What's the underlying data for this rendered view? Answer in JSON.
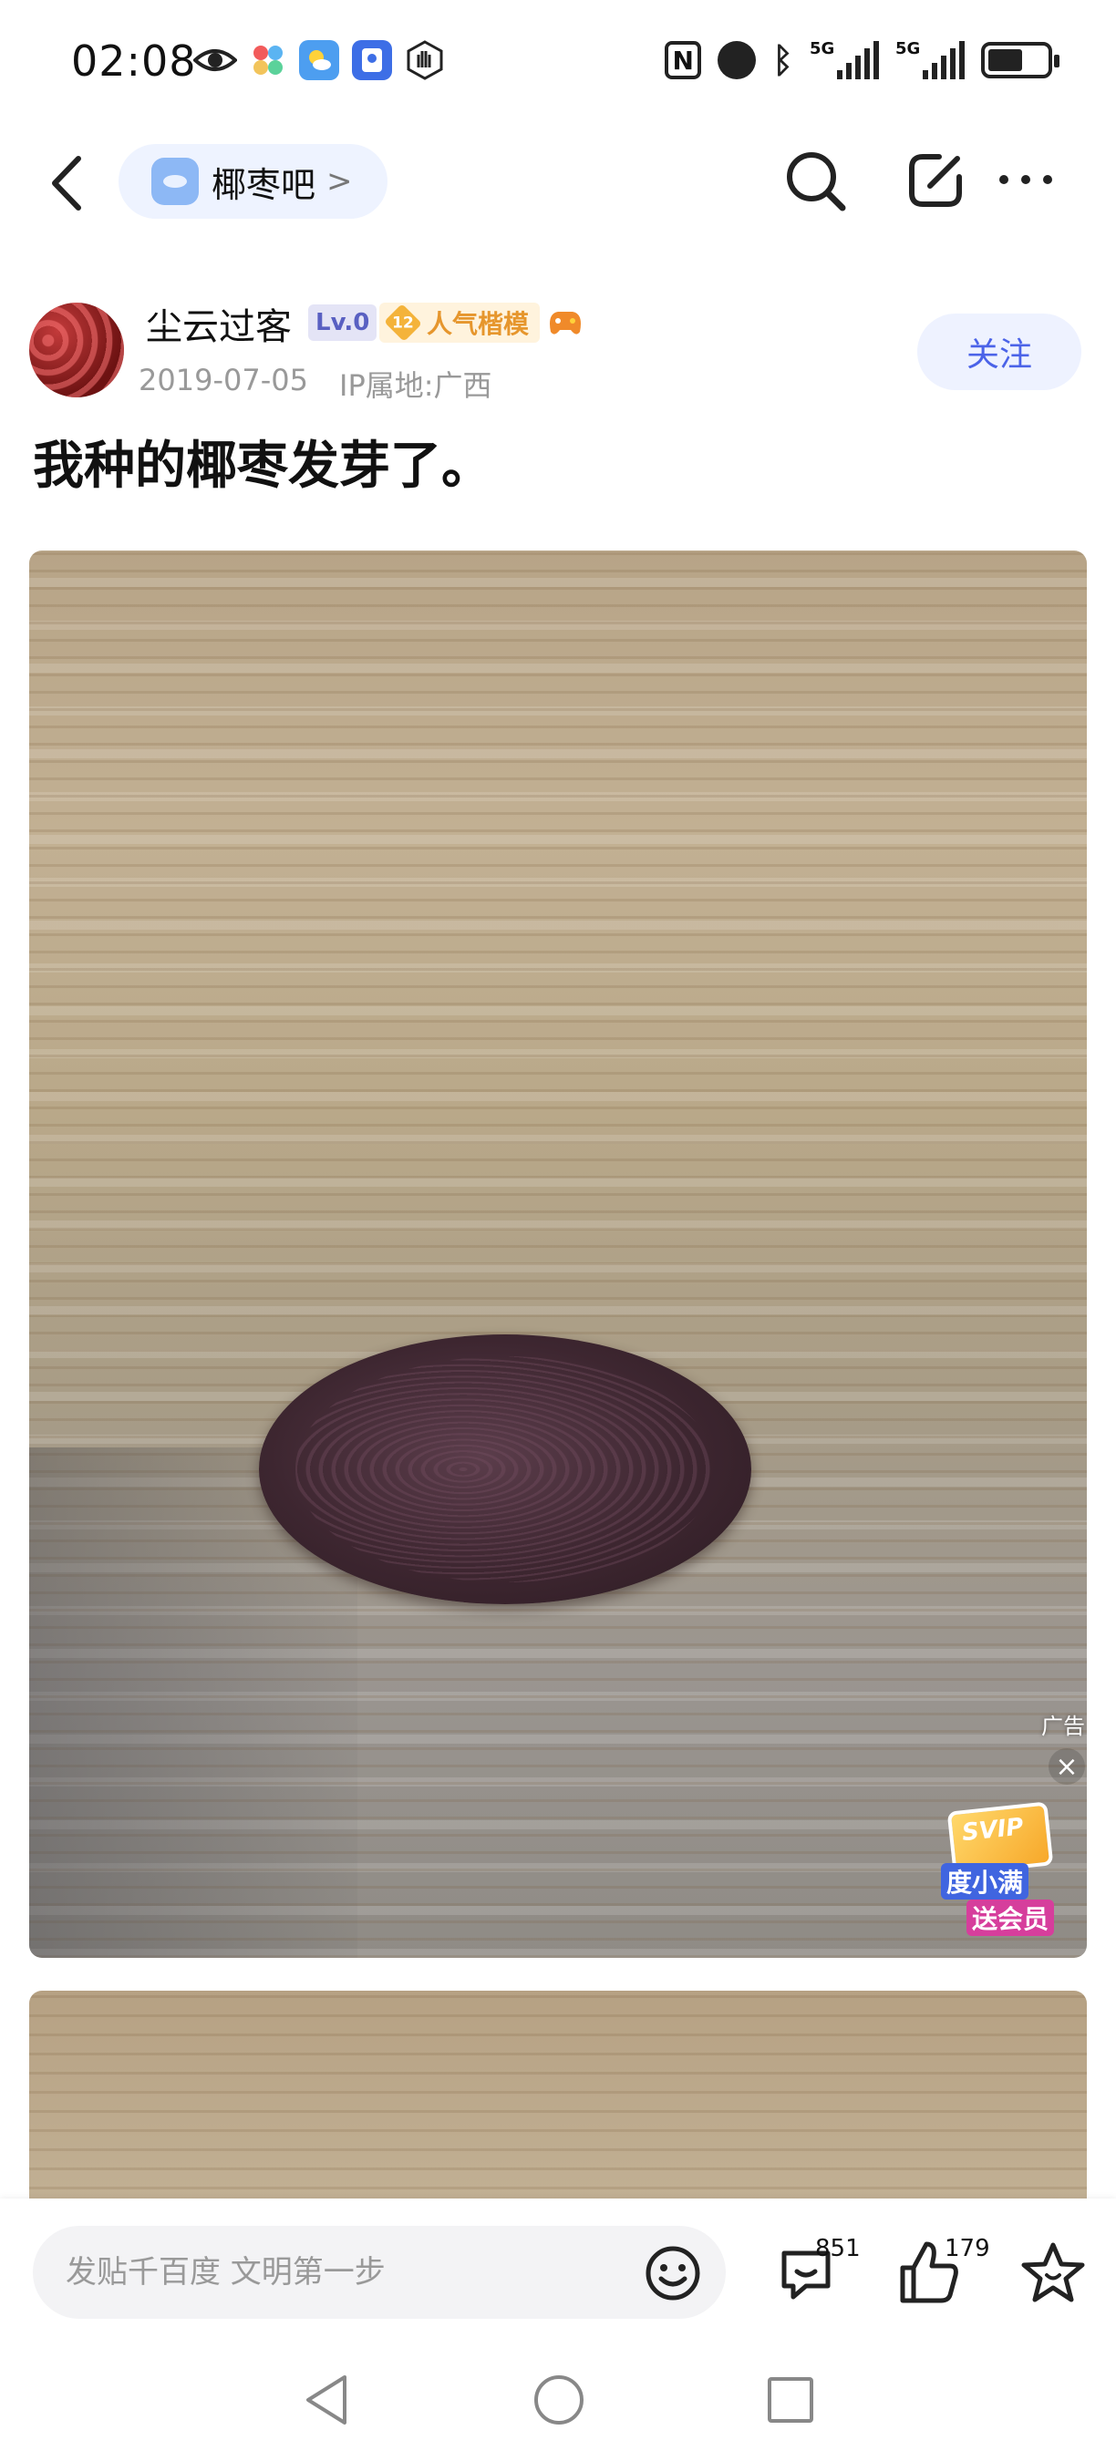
{
  "status_bar": {
    "time": "02:08",
    "left_icons": [
      "eye-icon",
      "pinwheel-icon",
      "weather-icon",
      "security-icon",
      "hand-icon"
    ],
    "right_icons": [
      "nfc-icon",
      "alarm-icon",
      "bluetooth-icon",
      "signal-5g-icon",
      "signal-5g-icon",
      "battery-icon"
    ],
    "network_label_1": "5G",
    "network_label_2": "5G",
    "nfc_label": "N"
  },
  "nav": {
    "forum_name": "椰枣吧",
    "forum_chevron": ">",
    "icons": [
      "back-icon",
      "search-icon",
      "edit-icon",
      "more-icon"
    ]
  },
  "author": {
    "name": "尘云过客",
    "level": "Lv.0",
    "popularity_level": "12",
    "popularity_title": "人气楷模",
    "date": "2019-07-05",
    "ip": "IP属地:广西",
    "follow_label": "关注"
  },
  "post": {
    "title": "我种的椰枣发芽了。"
  },
  "ad": {
    "label": "广告",
    "close": "×",
    "svip": "SVIP",
    "line1": "度小满",
    "line2": "送会员"
  },
  "bottom_bar": {
    "reply_placeholder": "发贴千百度 文明第一步",
    "comment_count": "851",
    "like_count": "179",
    "icons": [
      "emoji-icon",
      "comment-icon",
      "like-icon",
      "favorite-icon"
    ]
  },
  "system_nav": {
    "icons": [
      "back-triangle-icon",
      "home-circle-icon",
      "recent-square-icon"
    ]
  },
  "colors": {
    "accent": "#4b63e8",
    "follow_bg": "#eef2ff",
    "pill_bg": "#eef3ff",
    "badge_gold": "#e6962d"
  }
}
